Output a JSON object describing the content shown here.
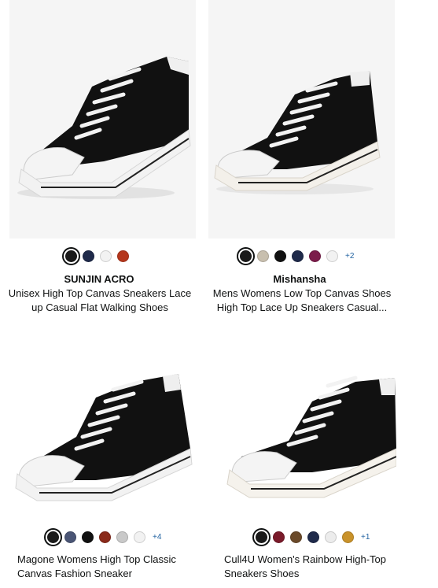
{
  "products": [
    {
      "brand": "SUNJIN ACRO",
      "title_line1": "Unisex High Top Canvas Sneakers Lace",
      "title_line2": "up Casual Flat Walking Shoes",
      "image_icon": "black-high-top-sneaker-image",
      "swatches": [
        "#1a1a1a",
        "#1f2a4a",
        "#f2f2f2",
        "#b5361c"
      ],
      "more_colors": ""
    },
    {
      "brand": "Mishansha",
      "title_line1": "Mens Womens Low Top Canvas Shoes",
      "title_line2": "High Top Lace Up Sneakers Casual...",
      "image_icon": "black-high-top-sneaker-image",
      "swatches": [
        "#1a1a1a",
        "#c8bfae",
        "#111111",
        "#1f2a4a",
        "#7b1c4a",
        "#f2f2f2"
      ],
      "more_colors": "+2"
    },
    {
      "brand": "",
      "title_line1": "Magone Womens High Top Classic",
      "title_line2": "Canvas Fashion Sneaker",
      "image_icon": "black-high-top-sneaker-image",
      "swatches": [
        "#1a1a1a",
        "#4a5575",
        "#111111",
        "#8a2a1a",
        "#c9c9c9",
        "#f2f2f2"
      ],
      "more_colors": "+4"
    },
    {
      "brand": "",
      "title_line1": "Cull4U Women's Rainbow High-Top",
      "title_line2": "Sneakers Shoes",
      "image_icon": "black-high-top-sneaker-image",
      "swatches": [
        "#1a1a1a",
        "#7a1a2a",
        "#6b4a2a",
        "#1f2a4a",
        "#ececec",
        "#c9922a"
      ],
      "more_colors": "+1"
    }
  ],
  "colors": {
    "link": "#2162a1",
    "text": "#0f1111",
    "image_bg": "#f5f5f5"
  }
}
